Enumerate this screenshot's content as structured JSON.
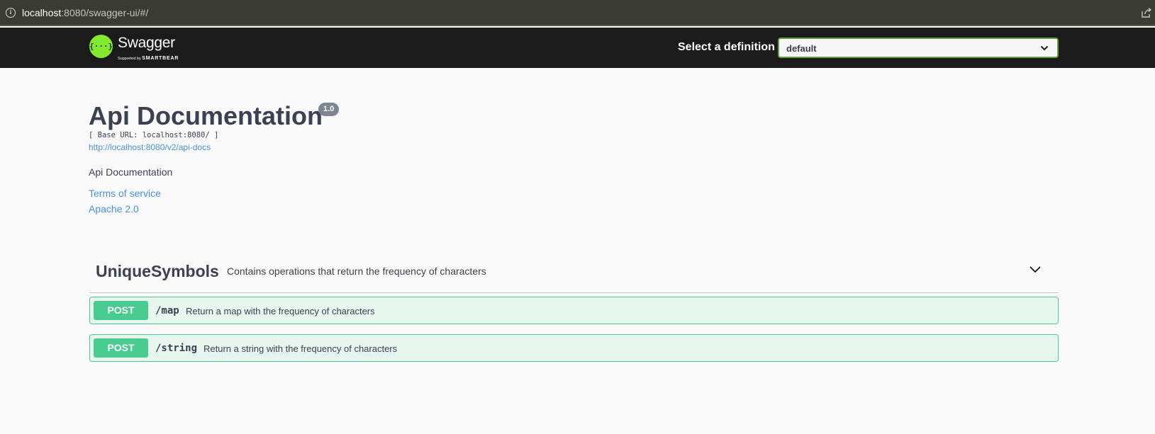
{
  "browser": {
    "url_host": "localhost",
    "url_rest": ":8080/swagger-ui/#/"
  },
  "topbar": {
    "logo_word": "Swagger",
    "logo_sub_prefix": "Supported by ",
    "logo_sub_brand": "SMARTBEAR",
    "logo_glyph": "{···}",
    "select_label": "Select a definition",
    "selected_definition": "default"
  },
  "info": {
    "title": "Api Documentation",
    "version": "1.0",
    "base_url": "[ Base URL: localhost:8080/ ]",
    "spec_link": "http://localhost:8080/v2/api-docs",
    "description": "Api Documentation",
    "terms_link": "Terms of service",
    "license_link": "Apache 2.0"
  },
  "tag": {
    "name": "UniqueSymbols",
    "description": "Contains operations that return the frequency of characters"
  },
  "operations": [
    {
      "method": "POST",
      "path": "/map",
      "summary": "Return a map with the frequency of characters"
    },
    {
      "method": "POST",
      "path": "/string",
      "summary": "Return a string with the frequency of characters"
    }
  ],
  "colors": {
    "accent_green": "#49cc90",
    "link_blue": "#4990e2",
    "logo_green": "#85ea2d",
    "topbar_bg": "#1b1b1b"
  }
}
